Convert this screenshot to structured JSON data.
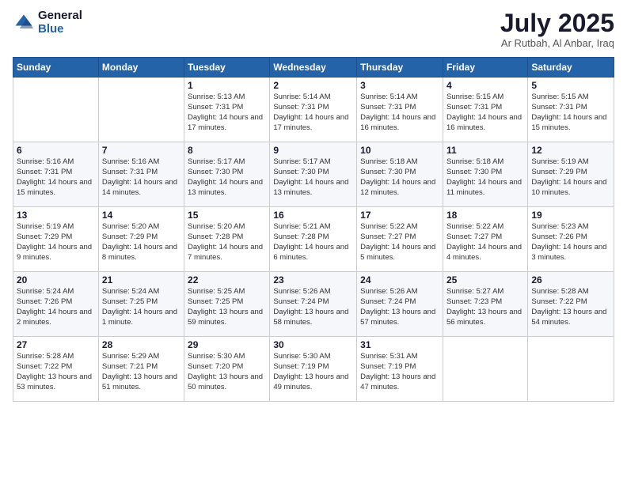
{
  "header": {
    "logo_general": "General",
    "logo_blue": "Blue",
    "title": "July 2025",
    "subtitle": "Ar Rutbah, Al Anbar, Iraq"
  },
  "weekdays": [
    "Sunday",
    "Monday",
    "Tuesday",
    "Wednesday",
    "Thursday",
    "Friday",
    "Saturday"
  ],
  "weeks": [
    [
      {
        "day": "",
        "info": ""
      },
      {
        "day": "",
        "info": ""
      },
      {
        "day": "1",
        "info": "Sunrise: 5:13 AM\nSunset: 7:31 PM\nDaylight: 14 hours and 17 minutes."
      },
      {
        "day": "2",
        "info": "Sunrise: 5:14 AM\nSunset: 7:31 PM\nDaylight: 14 hours and 17 minutes."
      },
      {
        "day": "3",
        "info": "Sunrise: 5:14 AM\nSunset: 7:31 PM\nDaylight: 14 hours and 16 minutes."
      },
      {
        "day": "4",
        "info": "Sunrise: 5:15 AM\nSunset: 7:31 PM\nDaylight: 14 hours and 16 minutes."
      },
      {
        "day": "5",
        "info": "Sunrise: 5:15 AM\nSunset: 7:31 PM\nDaylight: 14 hours and 15 minutes."
      }
    ],
    [
      {
        "day": "6",
        "info": "Sunrise: 5:16 AM\nSunset: 7:31 PM\nDaylight: 14 hours and 15 minutes."
      },
      {
        "day": "7",
        "info": "Sunrise: 5:16 AM\nSunset: 7:31 PM\nDaylight: 14 hours and 14 minutes."
      },
      {
        "day": "8",
        "info": "Sunrise: 5:17 AM\nSunset: 7:30 PM\nDaylight: 14 hours and 13 minutes."
      },
      {
        "day": "9",
        "info": "Sunrise: 5:17 AM\nSunset: 7:30 PM\nDaylight: 14 hours and 13 minutes."
      },
      {
        "day": "10",
        "info": "Sunrise: 5:18 AM\nSunset: 7:30 PM\nDaylight: 14 hours and 12 minutes."
      },
      {
        "day": "11",
        "info": "Sunrise: 5:18 AM\nSunset: 7:30 PM\nDaylight: 14 hours and 11 minutes."
      },
      {
        "day": "12",
        "info": "Sunrise: 5:19 AM\nSunset: 7:29 PM\nDaylight: 14 hours and 10 minutes."
      }
    ],
    [
      {
        "day": "13",
        "info": "Sunrise: 5:19 AM\nSunset: 7:29 PM\nDaylight: 14 hours and 9 minutes."
      },
      {
        "day": "14",
        "info": "Sunrise: 5:20 AM\nSunset: 7:29 PM\nDaylight: 14 hours and 8 minutes."
      },
      {
        "day": "15",
        "info": "Sunrise: 5:20 AM\nSunset: 7:28 PM\nDaylight: 14 hours and 7 minutes."
      },
      {
        "day": "16",
        "info": "Sunrise: 5:21 AM\nSunset: 7:28 PM\nDaylight: 14 hours and 6 minutes."
      },
      {
        "day": "17",
        "info": "Sunrise: 5:22 AM\nSunset: 7:27 PM\nDaylight: 14 hours and 5 minutes."
      },
      {
        "day": "18",
        "info": "Sunrise: 5:22 AM\nSunset: 7:27 PM\nDaylight: 14 hours and 4 minutes."
      },
      {
        "day": "19",
        "info": "Sunrise: 5:23 AM\nSunset: 7:26 PM\nDaylight: 14 hours and 3 minutes."
      }
    ],
    [
      {
        "day": "20",
        "info": "Sunrise: 5:24 AM\nSunset: 7:26 PM\nDaylight: 14 hours and 2 minutes."
      },
      {
        "day": "21",
        "info": "Sunrise: 5:24 AM\nSunset: 7:25 PM\nDaylight: 14 hours and 1 minute."
      },
      {
        "day": "22",
        "info": "Sunrise: 5:25 AM\nSunset: 7:25 PM\nDaylight: 13 hours and 59 minutes."
      },
      {
        "day": "23",
        "info": "Sunrise: 5:26 AM\nSunset: 7:24 PM\nDaylight: 13 hours and 58 minutes."
      },
      {
        "day": "24",
        "info": "Sunrise: 5:26 AM\nSunset: 7:24 PM\nDaylight: 13 hours and 57 minutes."
      },
      {
        "day": "25",
        "info": "Sunrise: 5:27 AM\nSunset: 7:23 PM\nDaylight: 13 hours and 56 minutes."
      },
      {
        "day": "26",
        "info": "Sunrise: 5:28 AM\nSunset: 7:22 PM\nDaylight: 13 hours and 54 minutes."
      }
    ],
    [
      {
        "day": "27",
        "info": "Sunrise: 5:28 AM\nSunset: 7:22 PM\nDaylight: 13 hours and 53 minutes."
      },
      {
        "day": "28",
        "info": "Sunrise: 5:29 AM\nSunset: 7:21 PM\nDaylight: 13 hours and 51 minutes."
      },
      {
        "day": "29",
        "info": "Sunrise: 5:30 AM\nSunset: 7:20 PM\nDaylight: 13 hours and 50 minutes."
      },
      {
        "day": "30",
        "info": "Sunrise: 5:30 AM\nSunset: 7:19 PM\nDaylight: 13 hours and 49 minutes."
      },
      {
        "day": "31",
        "info": "Sunrise: 5:31 AM\nSunset: 7:19 PM\nDaylight: 13 hours and 47 minutes."
      },
      {
        "day": "",
        "info": ""
      },
      {
        "day": "",
        "info": ""
      }
    ]
  ]
}
